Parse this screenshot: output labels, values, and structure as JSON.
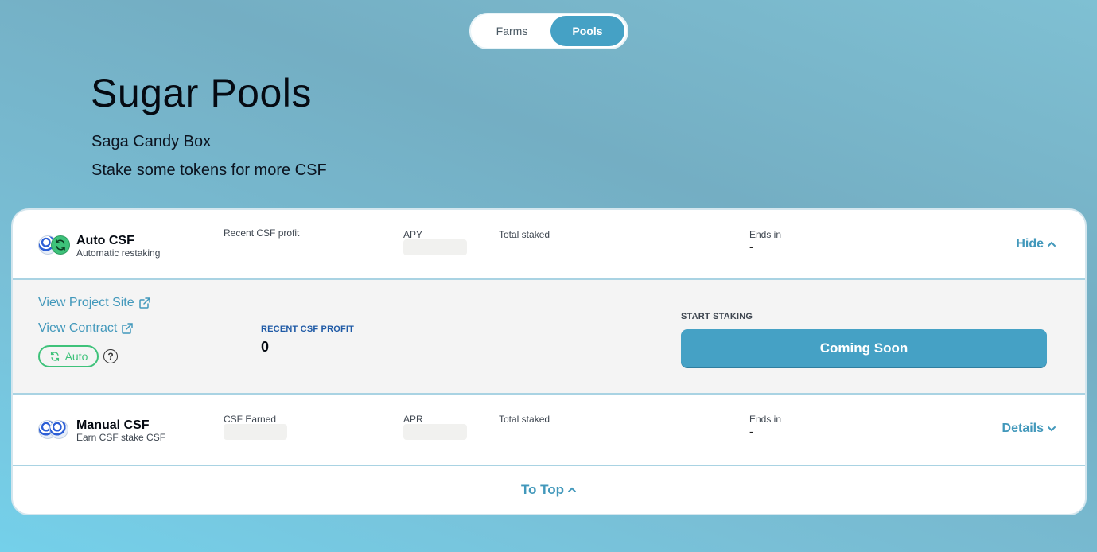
{
  "tabs": {
    "farms": "Farms",
    "pools": "Pools",
    "active": "Pools"
  },
  "header": {
    "title": "Sugar Pools",
    "subtitle1": "Saga Candy Box",
    "subtitle2": "Stake some tokens for more CSF"
  },
  "pools": [
    {
      "name": "Auto CSF",
      "desc": "Automatic restaking",
      "col1_label": "Recent CSF profit",
      "col2_label": "APY",
      "col3_label": "Total staked",
      "col4_label": "Ends in",
      "col4_value": "-",
      "action": "Hide",
      "details": {
        "project_link": "View Project Site",
        "contract_link": "View Contract",
        "badge": "Auto",
        "help": "?",
        "profit_label": "RECENT CSF PROFIT",
        "profit_value": "0",
        "stake_label": "START STAKING",
        "button": "Coming Soon"
      }
    },
    {
      "name": "Manual CSF",
      "desc": "Earn CSF stake CSF",
      "col1_label": "CSF Earned",
      "col2_label": "APR",
      "col3_label": "Total staked",
      "col4_label": "Ends in",
      "col4_value": "-",
      "action": "Details"
    }
  ],
  "footer": {
    "to_top": "To Top"
  },
  "colors": {
    "accent": "#45a1c5",
    "link": "#4298bb",
    "auto_green": "#3ec27a",
    "profit_label": "#1f5aa6"
  },
  "icons": [
    "csf-token-icon",
    "auto-refresh-icon",
    "external-link-icon",
    "chevron-up-icon",
    "chevron-down-icon",
    "question-icon"
  ]
}
